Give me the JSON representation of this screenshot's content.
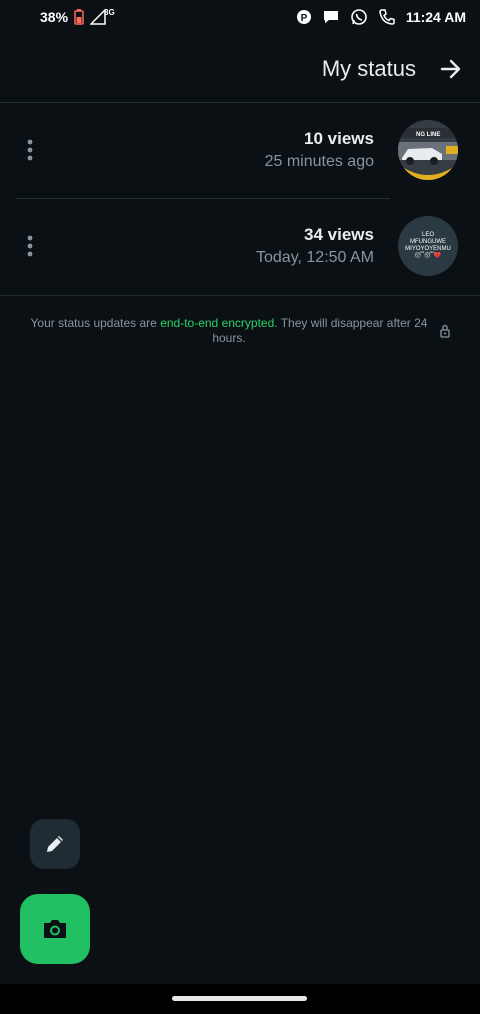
{
  "status_bar": {
    "battery": "38%",
    "network": "3G",
    "time": "11:24 AM"
  },
  "header": {
    "title": "My status"
  },
  "statuses": [
    {
      "views": "10 views",
      "time": "25 minutes ago"
    },
    {
      "views": "34 views",
      "time": "Today, 12:50 AM",
      "thumb_text": "LEO MFUNGUWE MIYOYOYENMU",
      "thumb_emoji": "😴😴💔"
    }
  ],
  "thumb1": {
    "banner": "NG LINE"
  },
  "note": {
    "prefix": "Your status updates are ",
    "link": "end-to-end encrypted",
    "suffix": ". They will disappear after 24 hours."
  },
  "colors": {
    "background": "#0b1014",
    "accent_green": "#21c063",
    "secondary_text": "#8696a0"
  }
}
